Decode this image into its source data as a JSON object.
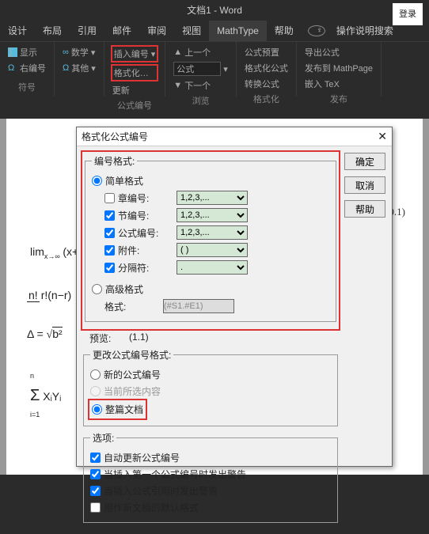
{
  "title": "文档1 - Word",
  "login": "登录",
  "tabs": [
    "设计",
    "布局",
    "引用",
    "邮件",
    "审阅",
    "视图",
    "MathType",
    "帮助"
  ],
  "tabsActive": "MathType",
  "helpSearch": "操作说明搜索",
  "ribbon": {
    "g1": {
      "items": [
        "显示",
        "右编号"
      ],
      "label": "符号"
    },
    "g1b": {
      "items": [
        "数学",
        "其他"
      ]
    },
    "g2": {
      "items": [
        "插入编号",
        "格式化…",
        "更新"
      ],
      "label": "公式编号"
    },
    "g3": {
      "items": [
        "上一个",
        "公式",
        "下一个"
      ],
      "label": "浏览"
    },
    "g4": {
      "items4": [
        "公式预置",
        "格式化公式",
        "转换公式"
      ],
      "label": "格式化"
    },
    "g5": {
      "items": [
        "导出公式",
        "发布到 MathPage",
        "嵌入 TeX"
      ],
      "label": "发布"
    }
  },
  "dialog": {
    "title": "格式化公式编号",
    "ok": "确定",
    "cancel": "取消",
    "help": "帮助",
    "fs_number": "编号格式:",
    "simple": "简单格式",
    "adv": "高级格式",
    "advlabel": "格式:",
    "advval": "(#S1.#E1)",
    "rows": [
      {
        "chk": false,
        "lbl": "章编号:",
        "val": "1,2,3,..."
      },
      {
        "chk": true,
        "lbl": "节编号:",
        "val": "1,2,3,..."
      },
      {
        "chk": true,
        "lbl": "公式编号:",
        "val": "1,2,3,..."
      },
      {
        "chk": true,
        "lbl": "附件:",
        "val": "( )"
      },
      {
        "chk": true,
        "lbl": "分隔符:",
        "val": "."
      }
    ],
    "preview_lbl": "预览:",
    "preview_val": "(1.1)",
    "fs_change": "更改公式编号格式:",
    "newnum": "新的公式编号",
    "curins": "当前所选内容",
    "whole": "整篇文档",
    "fs_opts": "选项:",
    "opts": [
      "自动更新公式编号",
      "当插入第一个公式编号时发出警告",
      "当插入公式引用时发出警告",
      "用作新文档的默认格式"
    ],
    "opts_chk": [
      true,
      true,
      true,
      false
    ]
  },
  "eqs": {
    "e1": "lim",
    "e1a": "x→∞",
    "e1b": "(x+",
    "e2n": "n!",
    "e2d": "r!(n−r)",
    "e3a": "Δ = ",
    "e3b": "b²",
    "e4": "Σ",
    "e4a": "n",
    "e4b": "i=1",
    "e4c": " XᵢYᵢ"
  },
  "eqnum": "(0.1)"
}
